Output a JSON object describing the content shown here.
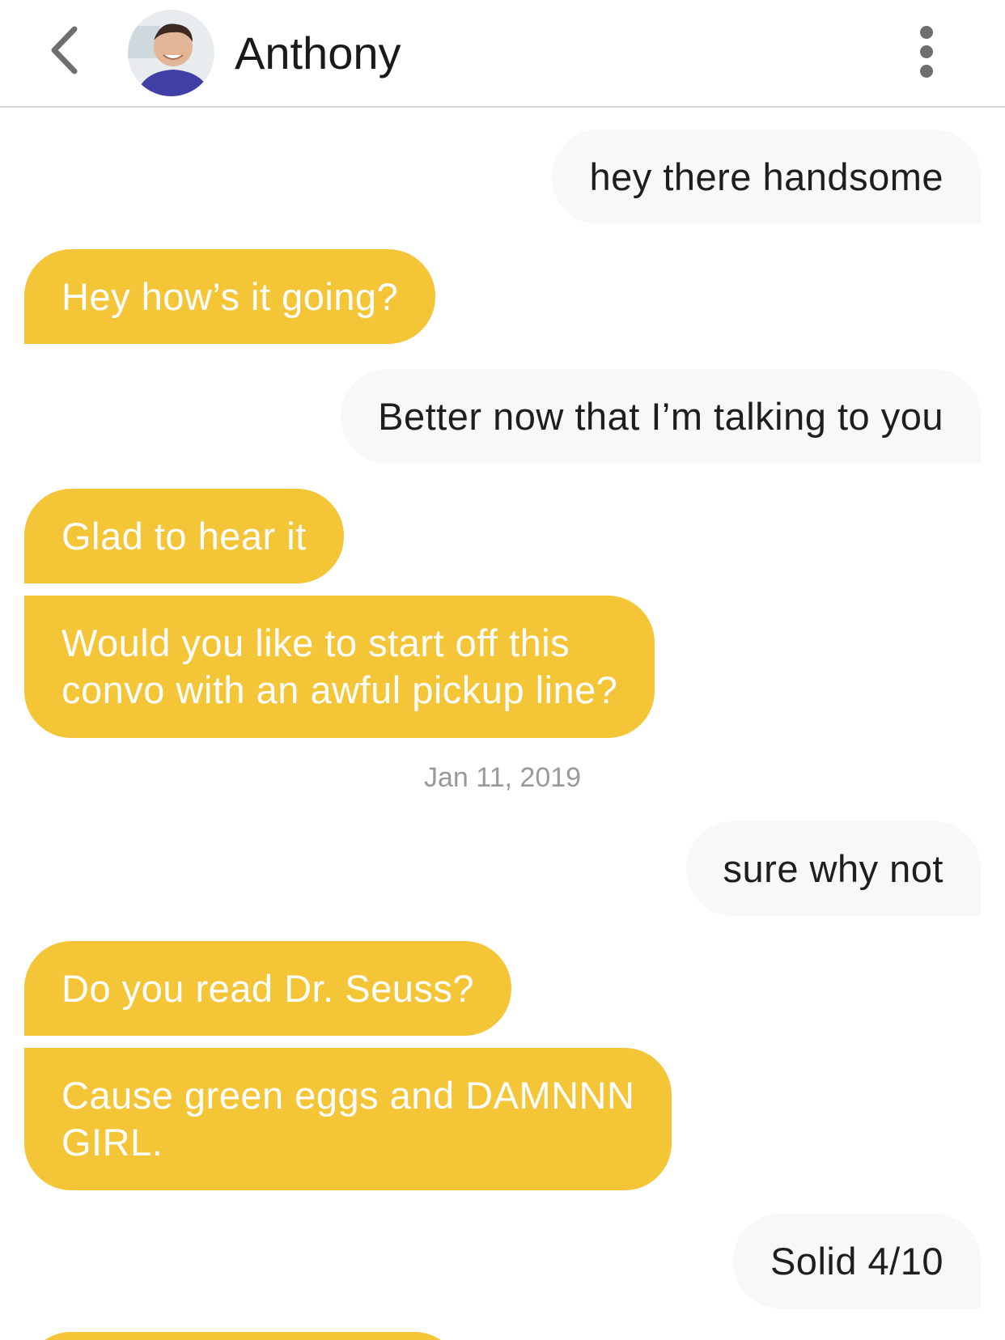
{
  "header": {
    "back_icon": "chevron-left-icon",
    "contact_name": "Anthony",
    "more_icon": "vertical-ellipsis-icon"
  },
  "colors": {
    "received_bubble": "#f5c538",
    "sent_bubble": "#f8f8f8",
    "received_text": "#ffffff",
    "sent_text": "#1e1e1e",
    "date_text": "#9a9a9a"
  },
  "messages": [
    {
      "direction": "sent",
      "text": "hey there handsome"
    },
    {
      "direction": "received",
      "text": "Hey how’s it going?"
    },
    {
      "direction": "sent",
      "text": "Better now that I’m talking to you"
    },
    {
      "direction": "received",
      "text": "Glad to hear it"
    },
    {
      "direction": "received",
      "text": "Would you like to start off this\nconvo with an awful pickup line?"
    },
    {
      "direction": "sent",
      "text": "sure why not"
    },
    {
      "direction": "received",
      "text": "Do you read Dr. Seuss?"
    },
    {
      "direction": "received",
      "text": "Cause green eggs and DAMNNN\nGIRL."
    },
    {
      "direction": "sent",
      "text": "Solid 4/10"
    }
  ],
  "date_stamp": "Jan 11, 2019"
}
